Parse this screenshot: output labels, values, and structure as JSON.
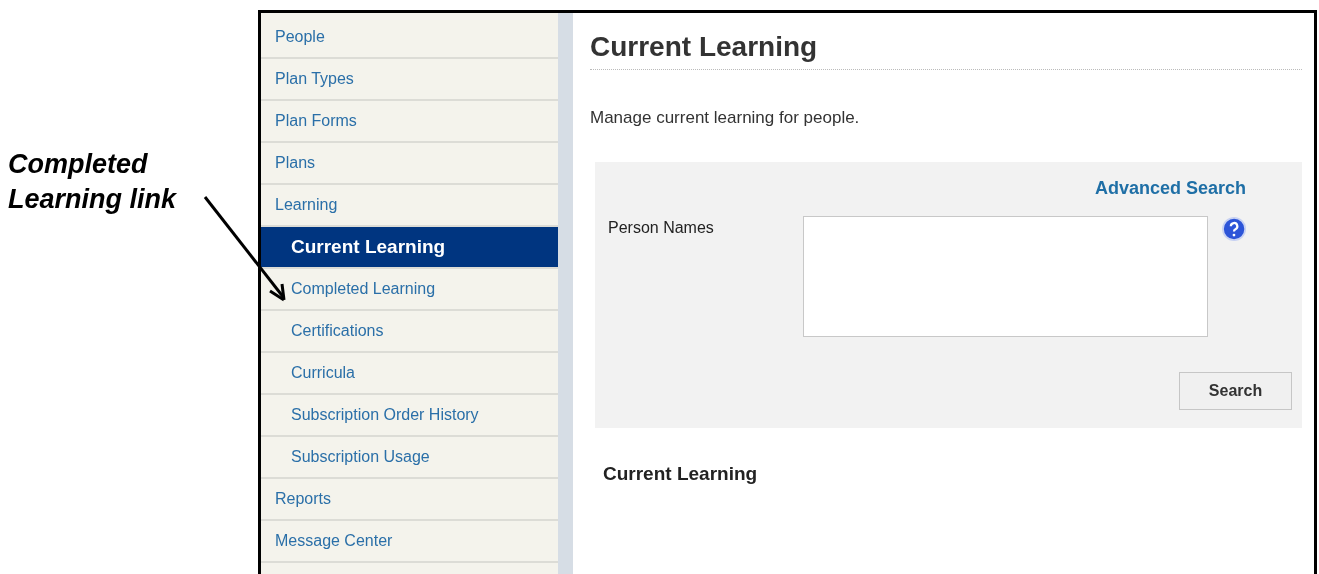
{
  "annotation": {
    "text": "Completed Learning link"
  },
  "sidebar": {
    "items": [
      {
        "label": "People",
        "selected": false
      },
      {
        "label": "Plan Types",
        "selected": false
      },
      {
        "label": "Plan Forms",
        "selected": false
      },
      {
        "label": "Plans",
        "selected": false
      },
      {
        "label": "Learning",
        "selected": false,
        "children": [
          {
            "label": "Current Learning",
            "selected": true
          },
          {
            "label": "Completed Learning",
            "selected": false
          },
          {
            "label": "Certifications",
            "selected": false
          },
          {
            "label": "Curricula",
            "selected": false
          },
          {
            "label": "Subscription Order History",
            "selected": false
          },
          {
            "label": "Subscription Usage",
            "selected": false
          }
        ]
      },
      {
        "label": "Reports",
        "selected": false
      },
      {
        "label": "Message Center",
        "selected": false
      }
    ]
  },
  "content": {
    "title": "Current Learning",
    "description": "Manage current learning for people.",
    "search_panel": {
      "advanced_link": "Advanced Search",
      "field_label": "Person Names",
      "search_button": "Search"
    },
    "section_title": "Current Learning"
  }
}
